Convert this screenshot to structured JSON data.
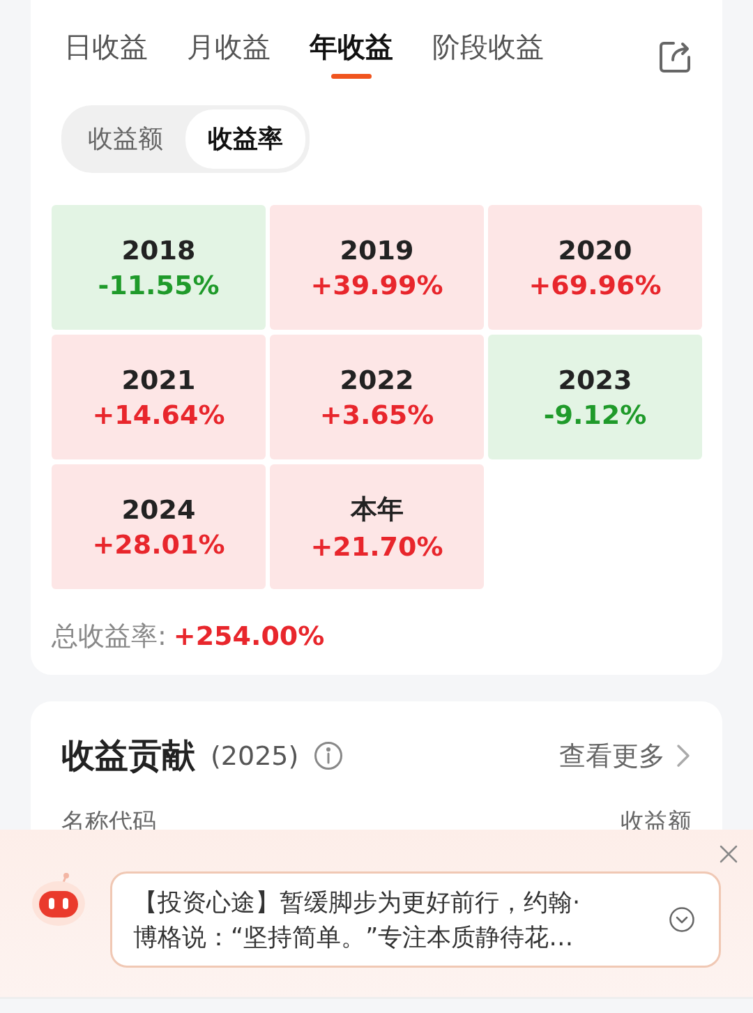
{
  "tabs": [
    {
      "label": "日收益",
      "selected": false
    },
    {
      "label": "月收益",
      "selected": false
    },
    {
      "label": "年收益",
      "selected": true
    },
    {
      "label": "阶段收益",
      "selected": false
    }
  ],
  "segments": [
    {
      "label": "收益额",
      "selected": false
    },
    {
      "label": "收益率",
      "selected": true
    }
  ],
  "years": [
    {
      "label": "2018",
      "value": "-11.55%",
      "kind": "down"
    },
    {
      "label": "2019",
      "value": "+39.99%",
      "kind": "up"
    },
    {
      "label": "2020",
      "value": "+69.96%",
      "kind": "up"
    },
    {
      "label": "2021",
      "value": "+14.64%",
      "kind": "up"
    },
    {
      "label": "2022",
      "value": "+3.65%",
      "kind": "up"
    },
    {
      "label": "2023",
      "value": "-9.12%",
      "kind": "down"
    },
    {
      "label": "2024",
      "value": "+28.01%",
      "kind": "up"
    },
    {
      "label": "本年",
      "value": "+21.70%",
      "kind": "up"
    }
  ],
  "total": {
    "label": "总收益率:",
    "value": "+254.00%"
  },
  "contribution": {
    "title": "收益贡献",
    "year": "(2025)",
    "more": "查看更多",
    "columns": [
      "名称代码",
      "收益额"
    ]
  },
  "banner": {
    "message": "【投资心途】暂缓脚步为更好前行，约翰·博格说：“坚持简单。”专注本质静待花…"
  }
}
